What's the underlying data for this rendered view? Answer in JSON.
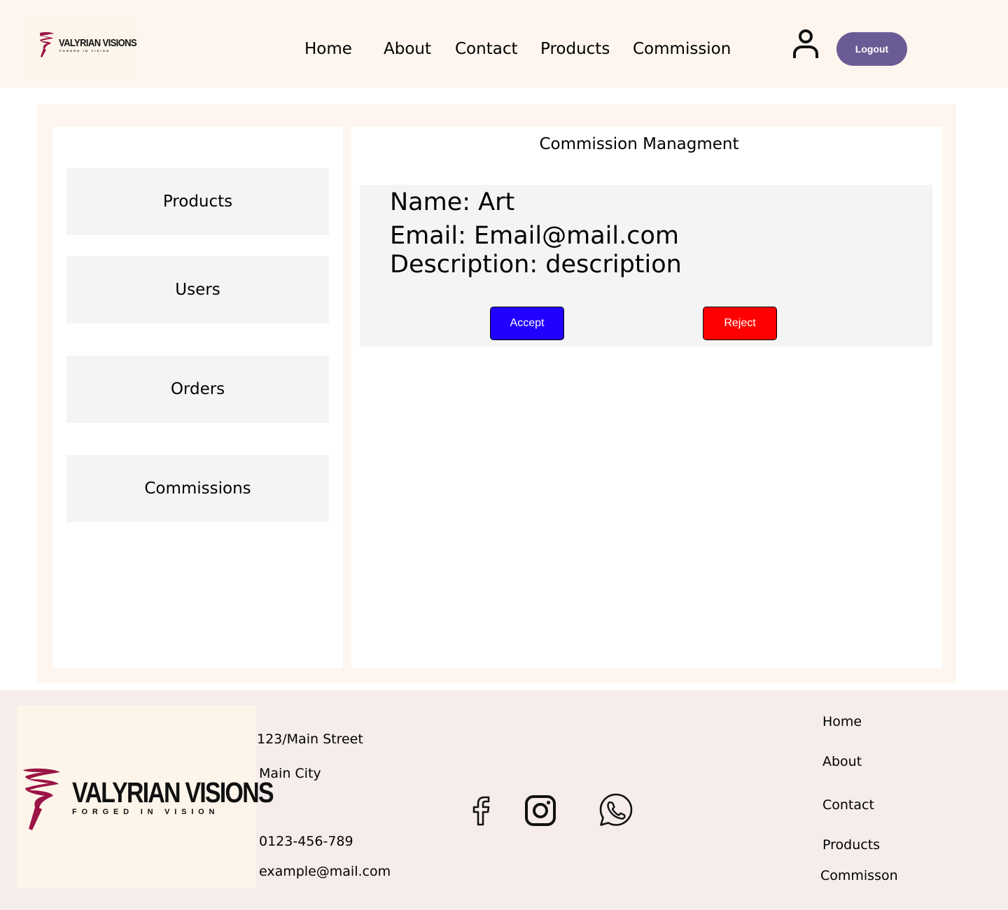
{
  "header": {
    "logo": {
      "brand": "VALYRIAN VISIONS",
      "tagline": "FORGED IN VISION"
    },
    "nav": [
      "Home",
      "About",
      "Contact",
      "Products",
      "Commission"
    ],
    "user_icon": "user-icon",
    "logout_label": "Logout",
    "logout_color": "#6b5b95"
  },
  "sidebar": {
    "items": [
      {
        "label": "Products"
      },
      {
        "label": "Users"
      },
      {
        "label": "Orders"
      },
      {
        "label": "Commissions"
      }
    ]
  },
  "main": {
    "title": "Commission Managment",
    "commission": {
      "name_line": "Name: Art",
      "email_line": "Email: Email@mail.com",
      "description_line": "Description: description",
      "accept_label": "Accept",
      "reject_label": "Reject",
      "accept_color": "#2200ff",
      "reject_color": "#ff0000"
    }
  },
  "footer": {
    "logo": {
      "brand": "VALYRIAN VISIONS",
      "tagline": "FORGED IN VISION"
    },
    "address_line1": "123/Main Street",
    "address_line2": "Main City",
    "phone": "0123-456-789",
    "email": "example@mail.com",
    "social": [
      "facebook-icon",
      "instagram-icon",
      "whatsapp-icon"
    ],
    "links": [
      "Home",
      "About",
      "Contact",
      "Products",
      "Commisson"
    ]
  },
  "colors": {
    "header_bg": "#fdf5ee",
    "footer_bg": "#f6ecec",
    "brand_accent": "#9b1446"
  }
}
